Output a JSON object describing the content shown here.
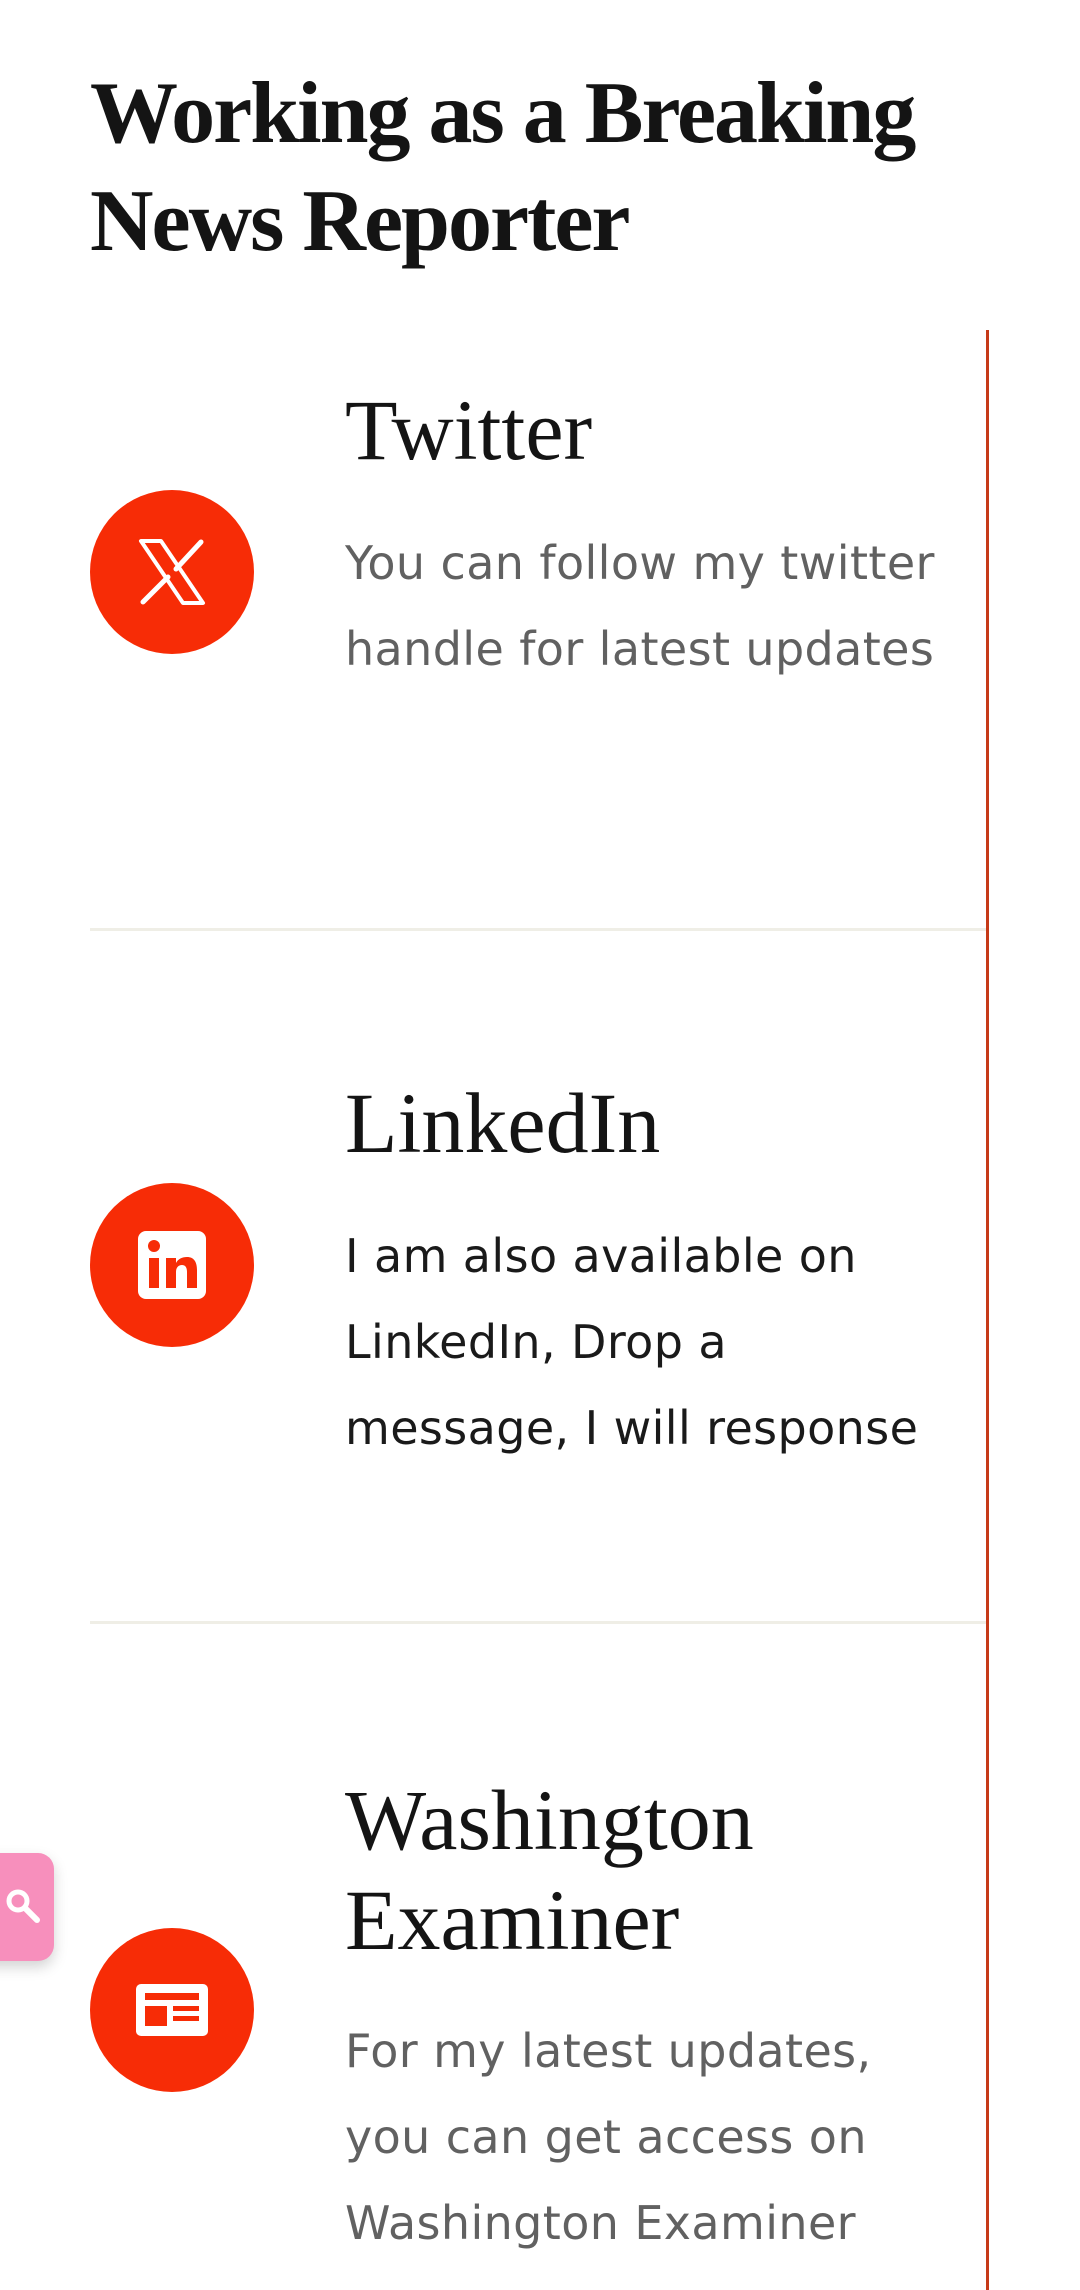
{
  "page": {
    "title": "Working as a Breaking News Reporter"
  },
  "cards": [
    {
      "title": "Twitter",
      "description": "You can follow my twitter handle for latest updates",
      "icon": "x-twitter-icon"
    },
    {
      "title": "LinkedIn",
      "description": "I am also available on LinkedIn, Drop a message, I will response",
      "icon": "linkedin-icon"
    },
    {
      "title": "Washington Examiner",
      "description": "For my latest updates, you can get access on Washington Examiner",
      "icon": "newspaper-icon"
    }
  ],
  "search_widget": {
    "icon": "search-icon"
  },
  "colors": {
    "accent": "#f72c06",
    "rule": "#c63a18",
    "divider": "#efeee6",
    "search_widget": "#f78fbc"
  }
}
